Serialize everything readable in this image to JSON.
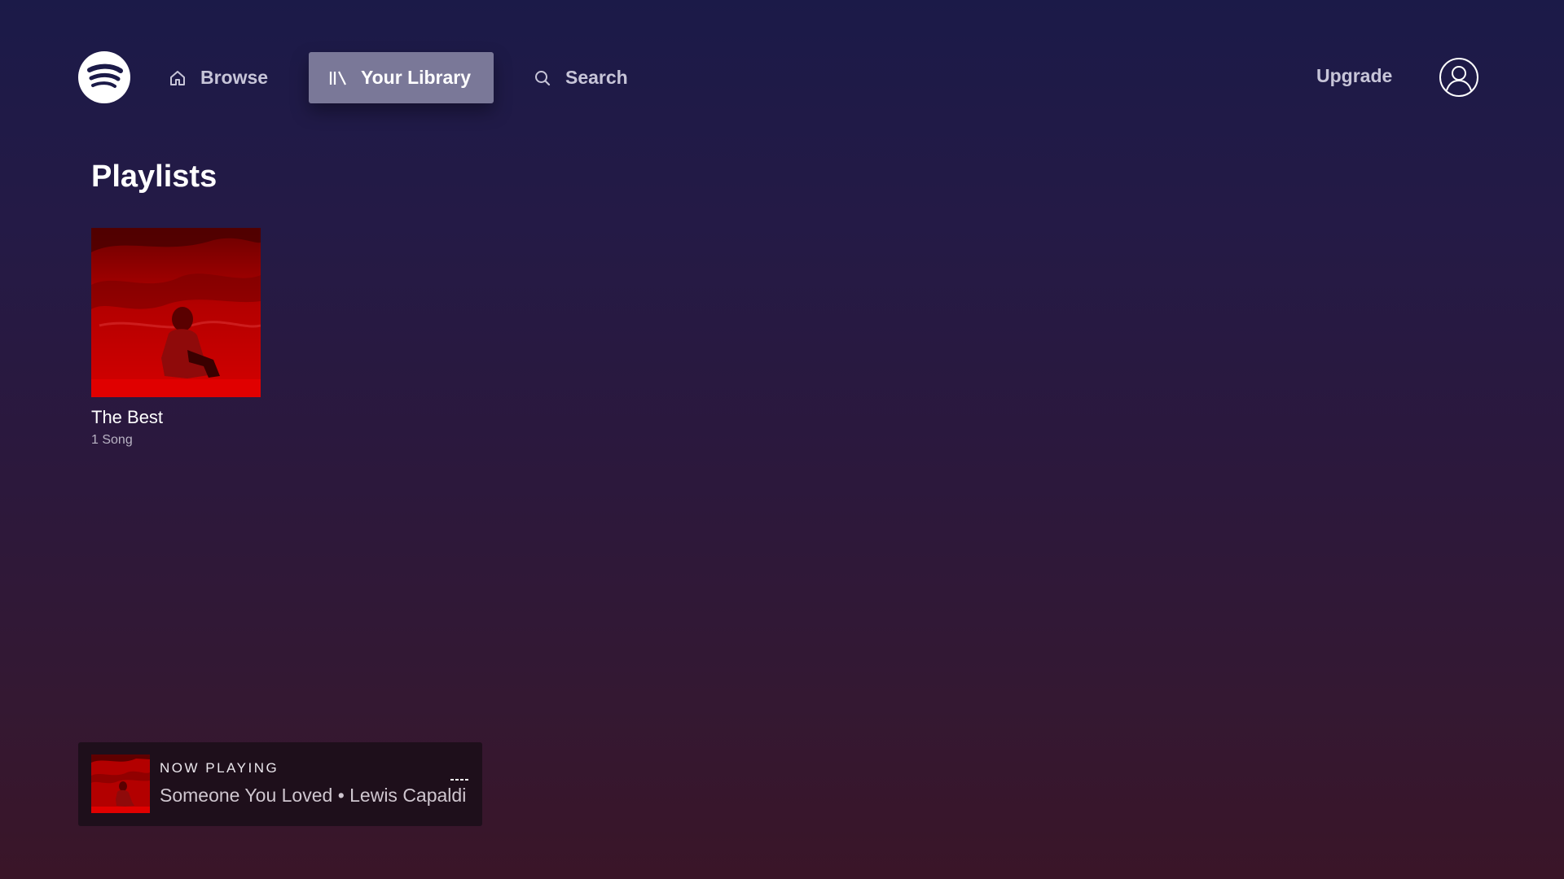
{
  "nav": {
    "logo_icon": "spotify-logo-icon",
    "items": [
      {
        "label": "Browse",
        "icon": "home-icon",
        "active": false
      },
      {
        "label": "Your Library",
        "icon": "library-icon",
        "active": true
      },
      {
        "label": "Search",
        "icon": "search-icon",
        "active": false
      }
    ],
    "upgrade_label": "Upgrade",
    "profile_icon": "user-profile-icon"
  },
  "library": {
    "section_title": "Playlists",
    "playlists": [
      {
        "name": "The Best",
        "meta": "1 Song",
        "cover_color": "#c90000"
      }
    ]
  },
  "now_playing": {
    "label": "NOW PLAYING",
    "track": "Someone You Loved • Lewis Capaldi",
    "indicator_icon": "playing-equalizer-icon"
  },
  "colors": {
    "bg_top": "#1b1a48",
    "bg_bottom": "#3a1528",
    "active_tab": "#7a7898",
    "cover_red": "#c90000",
    "now_playing_bg": "#1e0f1b"
  }
}
